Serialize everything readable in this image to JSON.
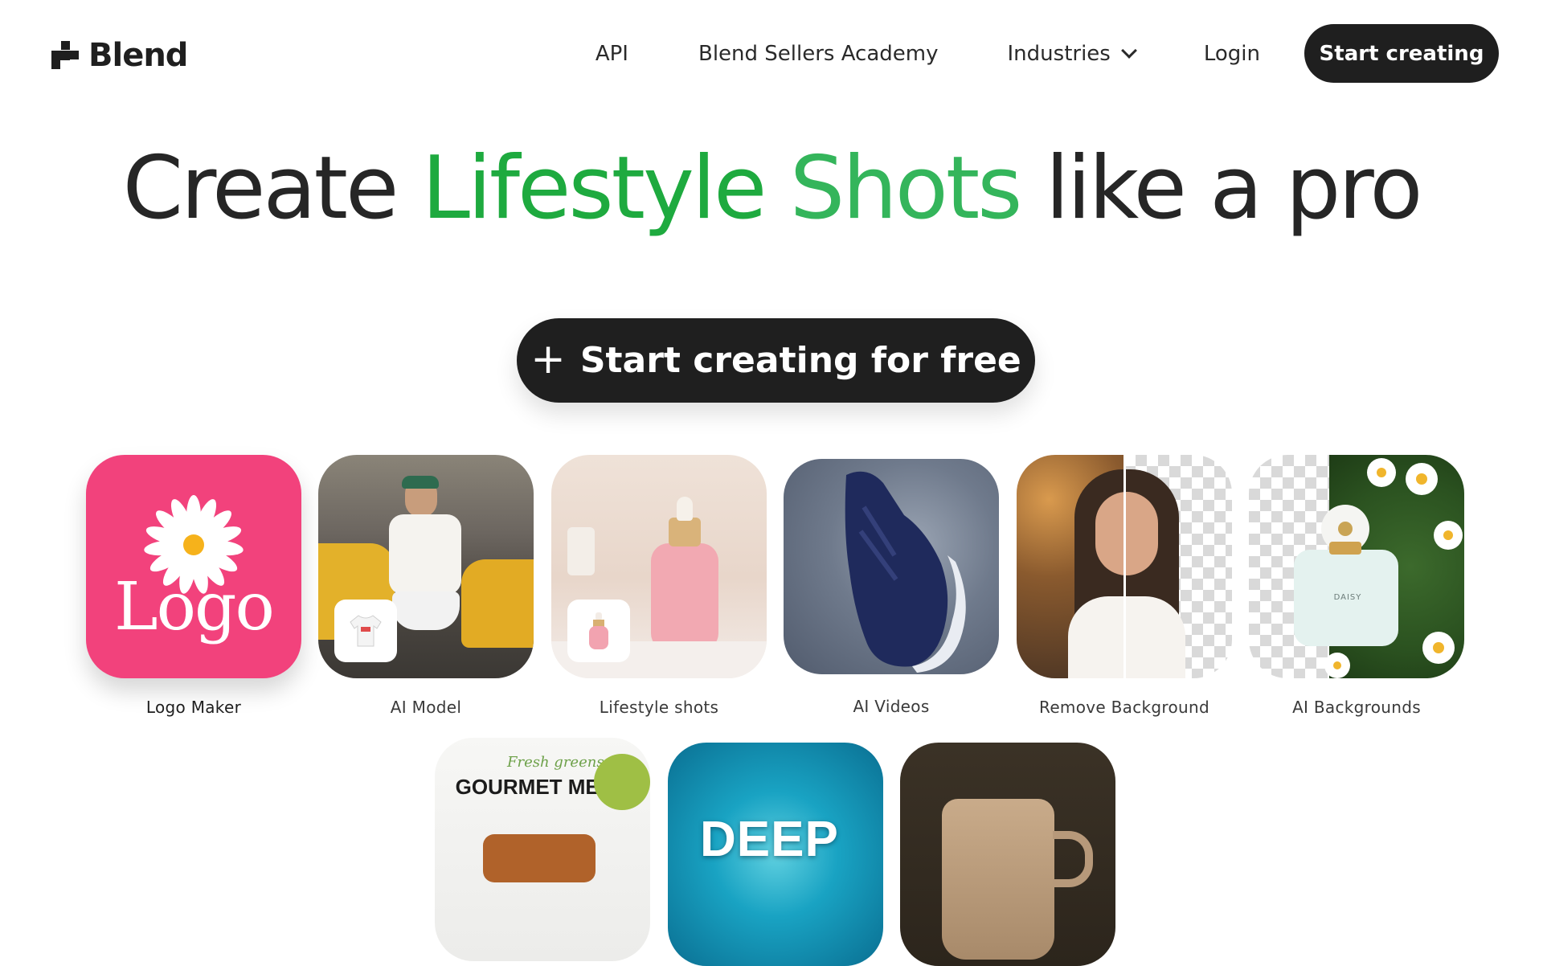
{
  "brand": {
    "name": "Blend",
    "accent_green": "#1eaa3f",
    "accent_green_light": "#34b55b",
    "dark": "#1f1f1f"
  },
  "nav": {
    "api": "API",
    "academy": "Blend Sellers Academy",
    "industries": "Industries",
    "login": "Login",
    "start_creating": "Start creating"
  },
  "hero": {
    "title_prefix": "Create",
    "title_highlight_1": "Lifestyle",
    "title_highlight_2": "Shots",
    "title_suffix": "like a pro",
    "cta_label": "Start creating for free",
    "cta_icon": "plus-icon"
  },
  "tiles": [
    {
      "label": "Logo Maker",
      "logo_text": "Logo",
      "icon": "daisy-icon"
    },
    {
      "label": "AI Model",
      "icon": "tshirt-icon"
    },
    {
      "label": "Lifestyle shots",
      "icon": "serum-bottle-icon"
    },
    {
      "label": "AI Videos"
    },
    {
      "label": "Remove Background"
    },
    {
      "label": "AI Backgrounds",
      "perfume_brand": "DAISY"
    }
  ],
  "bottom_tiles": [
    {
      "script": "Fresh greens",
      "title": "GOURMET MENU"
    },
    {
      "title": "DEEP"
    },
    {
      "subject": "coffee-mug"
    }
  ]
}
